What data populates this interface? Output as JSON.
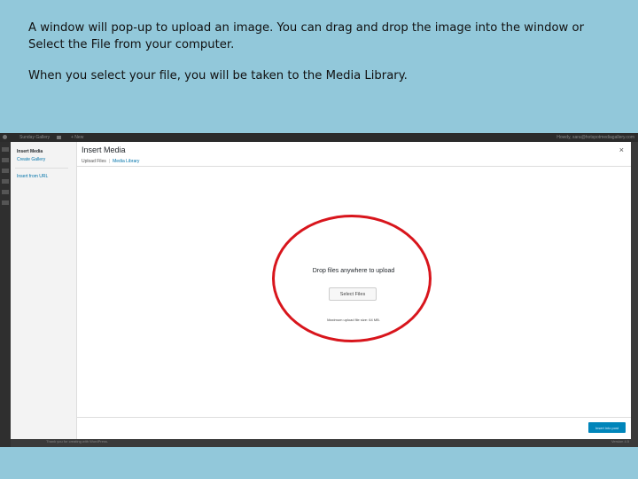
{
  "caption": {
    "line1": "A window will pop-up to upload an image.  You can drag and drop the image into the window or Select the File from your computer.",
    "line2": "When you select your file, you will be taken to the Media Library."
  },
  "adminbar": {
    "site_name": "Sunday Gallery",
    "new_label": "+ New",
    "howdy": "Howdy, sara@hotspotmediagallery.com"
  },
  "modal": {
    "sidebar": {
      "insert_media": "Insert Media",
      "create_gallery": "Create Gallery",
      "insert_from_url": "Insert from URL"
    },
    "title": "Insert Media",
    "close_icon": "×",
    "tabs": [
      "Upload Files",
      "Media Library"
    ],
    "drop_text": "Drop files anywhere to upload",
    "select_files": "Select Files",
    "max_size": "Maximum upload file size: 64 MB.",
    "insert_button": "Insert into post"
  },
  "footer": {
    "thanks": "Thank you for creating with WordPress.",
    "version": "Version 4.5"
  },
  "colors": {
    "background": "#92c8da",
    "highlight_ring": "#d8151c",
    "primary_button": "#0085ba"
  }
}
